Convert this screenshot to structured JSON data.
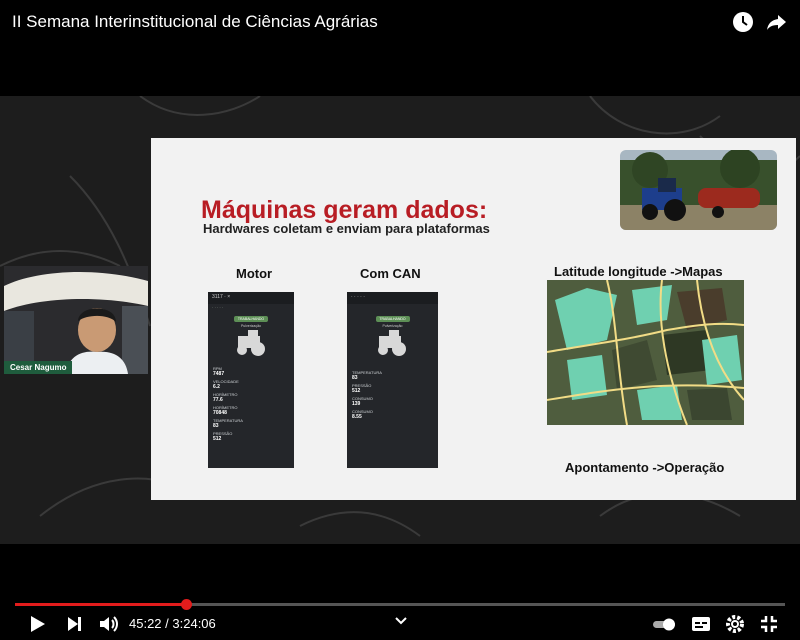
{
  "video": {
    "title": "II Semana Interinstitucional de Ciências Agrárias"
  },
  "slide": {
    "title": "Máquinas geram dados:",
    "subtitle": "Hardwares coletam e enviam para plataformas",
    "motor_label": "Motor",
    "can_label": "Com CAN",
    "map_label": "Latitude longitude ->Mapas",
    "apontamento_label": "Apontamento ->Operação"
  },
  "webcam": {
    "name": "Cesar Nagumo"
  },
  "player": {
    "current_time": "45:22",
    "separator": " / ",
    "duration": "3:24:06",
    "progress": 0.222
  }
}
